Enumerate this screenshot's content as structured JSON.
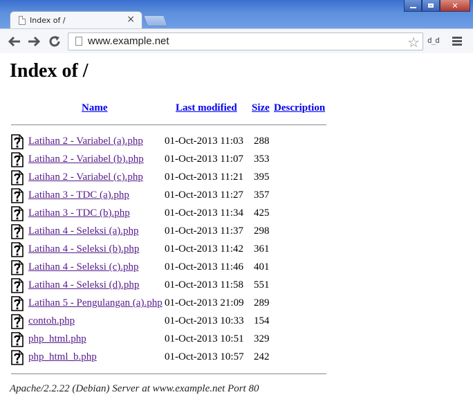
{
  "window": {
    "tab_title": "Index of /",
    "tab_close": "×",
    "address": "www.example.net",
    "extension_label": "d_d"
  },
  "page": {
    "heading": "Index of /",
    "columns": {
      "name": "Name",
      "last_modified": "Last modified",
      "size": "Size",
      "description": "Description"
    },
    "files": [
      {
        "name": "Latihan 2 - Variabel (a).php",
        "modified": "01-Oct-2013 11:03",
        "size": "288"
      },
      {
        "name": "Latihan 2 - Variabel (b).php",
        "modified": "01-Oct-2013 11:07",
        "size": "353"
      },
      {
        "name": "Latihan 2 - Variabel (c).php",
        "modified": "01-Oct-2013 11:21",
        "size": "395"
      },
      {
        "name": "Latihan 3 - TDC (a).php",
        "modified": "01-Oct-2013 11:27",
        "size": "357"
      },
      {
        "name": "Latihan 3 - TDC (b).php",
        "modified": "01-Oct-2013 11:34",
        "size": "425"
      },
      {
        "name": "Latihan 4 - Seleksi (a).php",
        "modified": "01-Oct-2013 11:37",
        "size": "298"
      },
      {
        "name": "Latihan 4 - Seleksi (b).php",
        "modified": "01-Oct-2013 11:42",
        "size": "361"
      },
      {
        "name": "Latihan 4 - Seleksi (c).php",
        "modified": "01-Oct-2013 11:46",
        "size": "401"
      },
      {
        "name": "Latihan 4 - Seleksi (d).php",
        "modified": "01-Oct-2013 11:58",
        "size": "551"
      },
      {
        "name": "Latihan 5 - Pengulangan (a).php",
        "modified": "01-Oct-2013 21:09",
        "size": "289"
      },
      {
        "name": "contoh.php",
        "modified": "01-Oct-2013 10:33",
        "size": "154"
      },
      {
        "name": "php_html.php",
        "modified": "01-Oct-2013 10:51",
        "size": "329"
      },
      {
        "name": "php_html_b.php",
        "modified": "01-Oct-2013 10:57",
        "size": "242"
      }
    ],
    "footer": "Apache/2.2.22 (Debian) Server at www.example.net Port 80"
  },
  "colors": {
    "link": "#0000ee",
    "visited": "#551a8b",
    "frame": "#5c8fdc"
  },
  "icons": [
    "minimize-icon",
    "maximize-icon",
    "close-icon",
    "back-arrow-icon",
    "forward-arrow-icon",
    "reload-icon",
    "bookmark-star-icon",
    "menu-icon",
    "unknown-file-icon"
  ]
}
